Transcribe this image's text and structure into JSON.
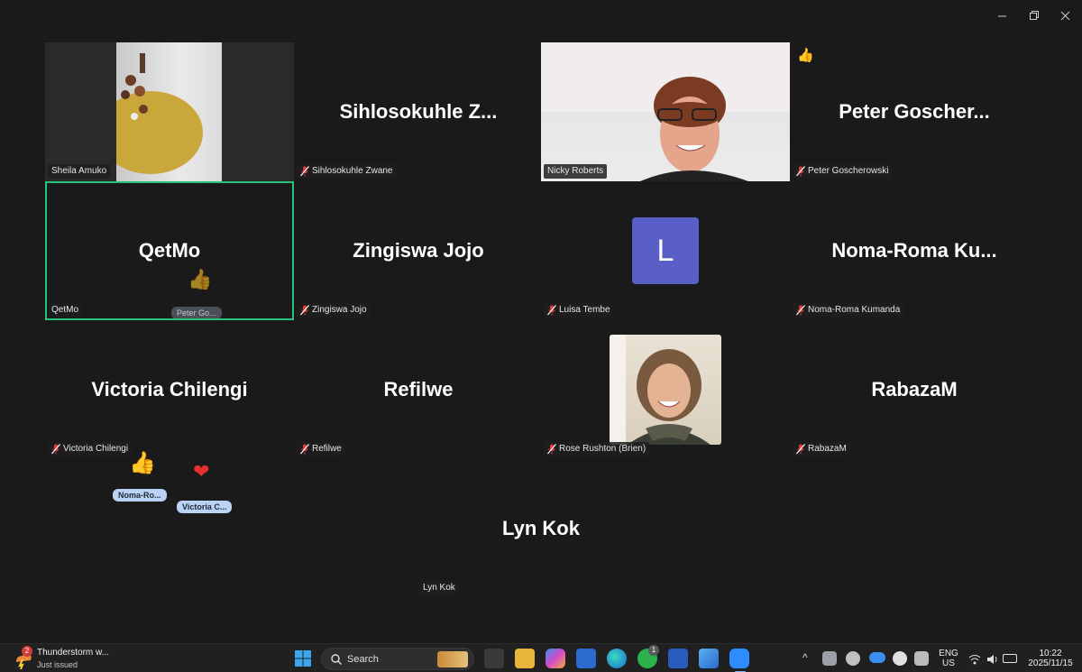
{
  "window": {
    "minimize_icon": "minimize-icon",
    "restore_icon": "restore-icon",
    "close_icon": "close-icon"
  },
  "participants": {
    "sheila": {
      "label": "Sheila Amuko"
    },
    "sihlosokuhle": {
      "display": "Sihlosokuhle  Z...",
      "label": "Sihlosokuhle Zwane"
    },
    "nicky": {
      "label": "Nicky Roberts"
    },
    "peter": {
      "display": "Peter  Goscher...",
      "label": "Peter Goscherowski"
    },
    "qetmo": {
      "display": "QetMo",
      "label": "QetMo",
      "reaction_pill": "Peter Go..."
    },
    "zingiswa": {
      "display": "Zingiswa Jojo",
      "label": "Zingiswa Jojo"
    },
    "luisa": {
      "avatar_letter": "L",
      "label": "Luisa Tembe"
    },
    "noma": {
      "display": "Noma-Roma  Ku...",
      "label": "Noma-Roma Kumanda"
    },
    "victoria": {
      "display": "Victoria Chilengi",
      "label": "Victoria Chilengi"
    },
    "refilwe": {
      "display": "Refilwe",
      "label": "Refilwe"
    },
    "rose": {
      "label": "Rose Rushton (Brien)"
    },
    "rabaza": {
      "display": "RabazaM",
      "label": "RabazaM"
    },
    "lyn": {
      "display": "Lyn Kok",
      "label": "Lyn Kok"
    }
  },
  "reactions": {
    "pill_noma": "Noma-Ro...",
    "pill_victoria": "Victoria  C..."
  },
  "colors": {
    "active_border": "#27c37d",
    "avatar_bg": "#5a5fc8",
    "reaction_pill": "#b9d2f5"
  },
  "taskbar": {
    "weather_title": "Thunderstorm w...",
    "weather_subtitle": "Just issued",
    "weather_badge": "2",
    "search_placeholder": "Search",
    "whatsapp_badge": "1",
    "lang_top": "ENG",
    "lang_bottom": "US",
    "time": "10:22",
    "date": "2025/11/15"
  }
}
